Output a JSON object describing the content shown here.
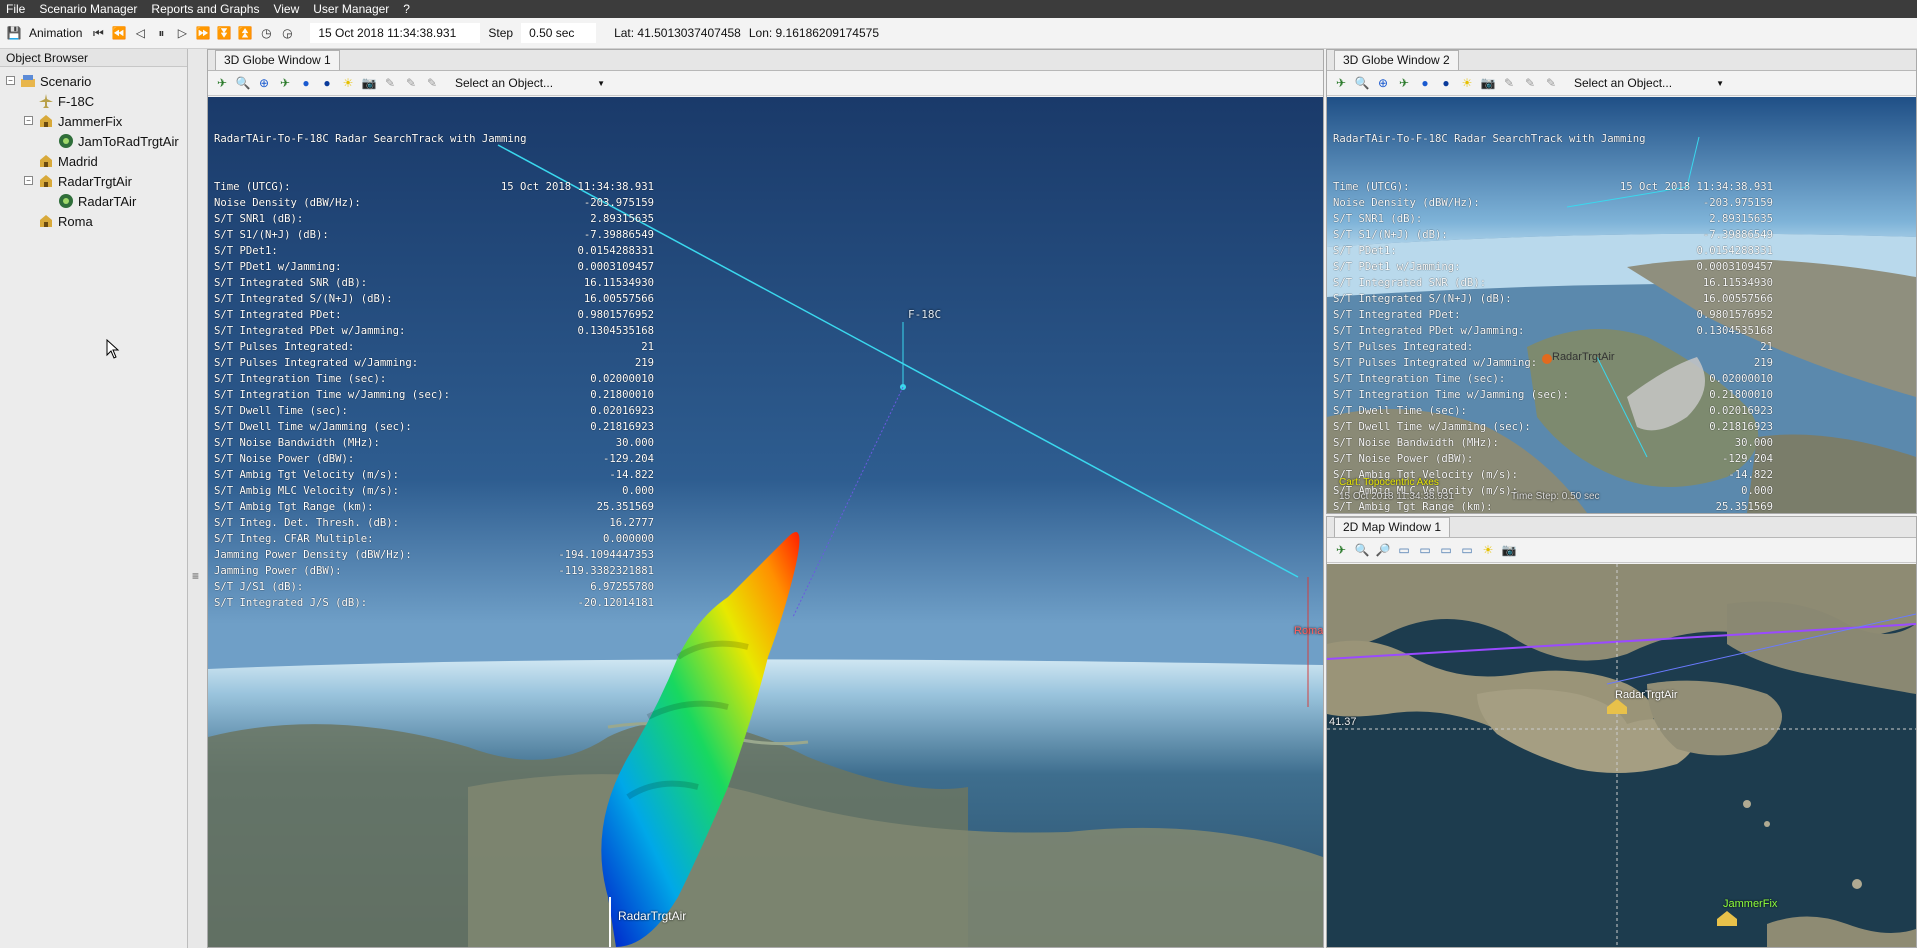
{
  "menu": [
    "File",
    "Scenario Manager",
    "Reports and Graphs",
    "View",
    "User Manager",
    "?"
  ],
  "toolbar": {
    "animation_label": "Animation",
    "time": "15 Oct 2018 11:34:38.931",
    "step_label": "Step",
    "step": "0.50 sec",
    "lat": "Lat: 41.5013037407458",
    "lon": "Lon: 9.16186209174575"
  },
  "object_browser": {
    "title": "Object Browser",
    "items": [
      "Scenario",
      "F-18C",
      "JammerFix",
      "JamToRadTrgtAir",
      "Madrid",
      "RadarTrgtAir",
      "RadarTAir",
      "Roma"
    ]
  },
  "win1": {
    "tab": "3D Globe Window 1",
    "select": "Select an Object...",
    "labels": {
      "f18": "F-18C",
      "radar": "RadarTrgtAir",
      "roma": "Roma"
    }
  },
  "win2": {
    "tab": "3D Globe Window 2",
    "select": "Select an Object...",
    "labels": {
      "radar": "RadarTrgtAir",
      "axes": "Cart: Topocentric Axes",
      "bottom_time": "15 Oct 2018 11:34:38.931",
      "bottom_step": "Time Step: 0.50 sec"
    }
  },
  "map": {
    "tab": "2D Map Window 1",
    "lat_label": "41.37",
    "radar": "RadarTrgtAir",
    "jammer": "JammerFix"
  },
  "report": {
    "title": "RadarTAir-To-F-18C Radar SearchTrack with Jamming",
    "rows": [
      [
        "Time (UTCG):",
        "15 Oct 2018 11:34:38.931"
      ],
      [
        "Noise Density (dBW/Hz):",
        "-203.975159"
      ],
      [
        "S/T SNR1 (dB):",
        "2.89315635"
      ],
      [
        "S/T S1/(N+J) (dB):",
        "-7.39886549"
      ],
      [
        "S/T PDet1:",
        "0.0154288331"
      ],
      [
        "S/T PDet1 w/Jamming:",
        "0.0003109457"
      ],
      [
        "S/T Integrated SNR (dB):",
        "16.11534930"
      ],
      [
        "S/T Integrated S/(N+J) (dB):",
        "16.00557566"
      ],
      [
        "S/T Integrated PDet:",
        "0.9801576952"
      ],
      [
        "S/T Integrated PDet w/Jamming:",
        "0.1304535168"
      ],
      [
        "S/T Pulses Integrated:",
        "21"
      ],
      [
        "S/T Pulses Integrated w/Jamming:",
        "219"
      ],
      [
        "S/T Integration Time (sec):",
        "0.02000010"
      ],
      [
        "S/T Integration Time w/Jamming (sec):",
        "0.21800010"
      ],
      [
        "S/T Dwell Time (sec):",
        "0.02016923"
      ],
      [
        "S/T Dwell Time w/Jamming (sec):",
        "0.21816923"
      ],
      [
        "S/T Noise Bandwidth (MHz):",
        "30.000"
      ],
      [
        "S/T Noise Power (dBW):",
        "-129.204"
      ],
      [
        "S/T Ambig Tgt Velocity (m/s):",
        "-14.822"
      ],
      [
        "S/T Ambig MLC Velocity (m/s):",
        "0.000"
      ],
      [
        "S/T Ambig Tgt Range (km):",
        "25.351569"
      ],
      [
        "S/T Integ. Det. Thresh. (dB):",
        "16.2777"
      ],
      [
        "S/T Integ. CFAR Multiple:",
        "0.000000"
      ],
      [
        "Jamming Power Density (dBW/Hz):",
        "-194.1094447353"
      ],
      [
        "Jamming Power (dBW):",
        "-119.3382321881"
      ],
      [
        "S/T J/S1 (dB):",
        "6.97255780"
      ],
      [
        "S/T Integrated J/S (dB):",
        "-20.12014181"
      ]
    ]
  }
}
